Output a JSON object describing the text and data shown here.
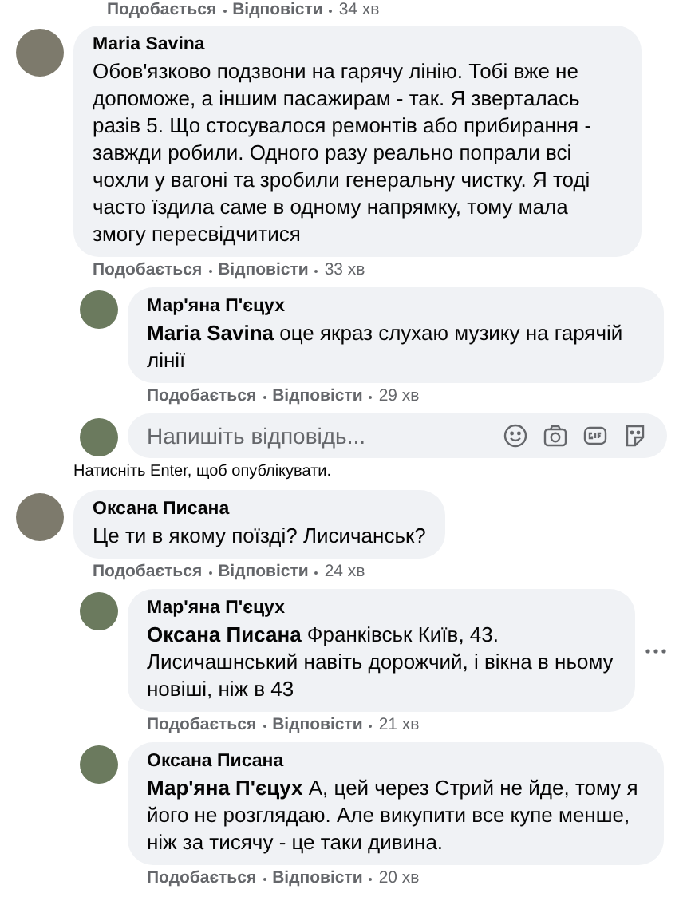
{
  "top_actions": {
    "like": "Подобається",
    "reply": "Відповісти",
    "time": "34 хв"
  },
  "comments": [
    {
      "author": "Maria Savina",
      "text": "Обов'язково подзвони на гарячу лінію. Тобі вже не допоможе, а іншим пасажирам - так. Я зверталась разів 5. Що стосувалося ремонтів або прибирання - завжди робили. Одного разу реально попрали всі чохли у вагоні та зробили генеральну чистку. Я тоді часто їздила саме в одному напрямку, тому мала змогу пересвідчитися",
      "like": "Подобається",
      "reply": "Відповісти",
      "time": "33 хв",
      "menu": false,
      "children": [
        {
          "author": "Мар'яна П'єцух",
          "text": "**Maria Savina** оце якраз слухаю музику на гарячій лінії",
          "like": "Подобається",
          "reply": "Відповісти",
          "time": "29 хв",
          "menu": false
        }
      ],
      "reply_box": {
        "placeholder": "Напишіть відповідь...",
        "hint": "Натисніть Enter, щоб опублікувати."
      }
    },
    {
      "author": "Оксана Писана",
      "text": "Це ти в якому поїзді? Лисичанськ?",
      "like": "Подобається",
      "reply": "Відповісти",
      "time": "24 хв",
      "menu": false,
      "children": [
        {
          "author": "Мар'яна П'єцух",
          "text": "**Оксана Писана** Франківськ Київ, 43. Лисичашнський навіть дорожчий, і вікна в ньому новіші, ніж в 43",
          "like": "Подобається",
          "reply": "Відповісти",
          "time": "21 хв",
          "menu": true
        },
        {
          "author": "Оксана Писана",
          "text": "**Мар'яна П'єцух** А, цей через Стрий не йде, тому я його не розглядаю. Але викупити все купе менше, ніж за тисячу - це таки дивина.",
          "like": "Подобається",
          "reply": "Відповісти",
          "time": "20 хв",
          "menu": false
        }
      ]
    }
  ]
}
